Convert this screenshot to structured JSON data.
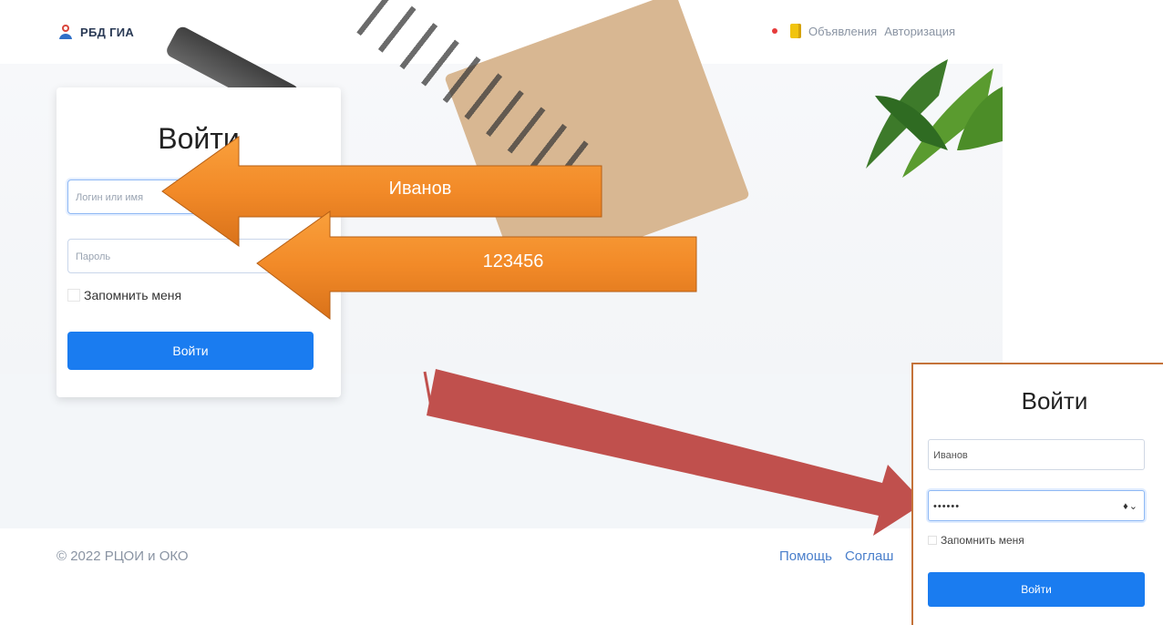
{
  "header": {
    "brand": "РБД ГИА",
    "nav": {
      "announcements": "Объявления",
      "login": "Авторизация"
    }
  },
  "login_form": {
    "title": "Войти",
    "login_placeholder": "Логин или имя",
    "password_placeholder": "Пароль",
    "remember_label": "Запомнить меня",
    "submit_label": "Войти"
  },
  "annotations": {
    "login_hint": "Иванов",
    "password_hint": "123456"
  },
  "inset": {
    "title": "Войти",
    "login_value": "Иванов",
    "password_value": "••••••",
    "eye_glyph": "♦⌄",
    "remember_label": "Запомнить меня",
    "submit_label": "Войти"
  },
  "footer": {
    "copyright": "© 2022 РЦОИ и ОКО",
    "links": [
      "Помощь",
      "Соглаш"
    ]
  },
  "colors": {
    "primary": "#1a7cf0",
    "orange_arrow": "#f28a28",
    "red_arrow": "#c0504d"
  }
}
